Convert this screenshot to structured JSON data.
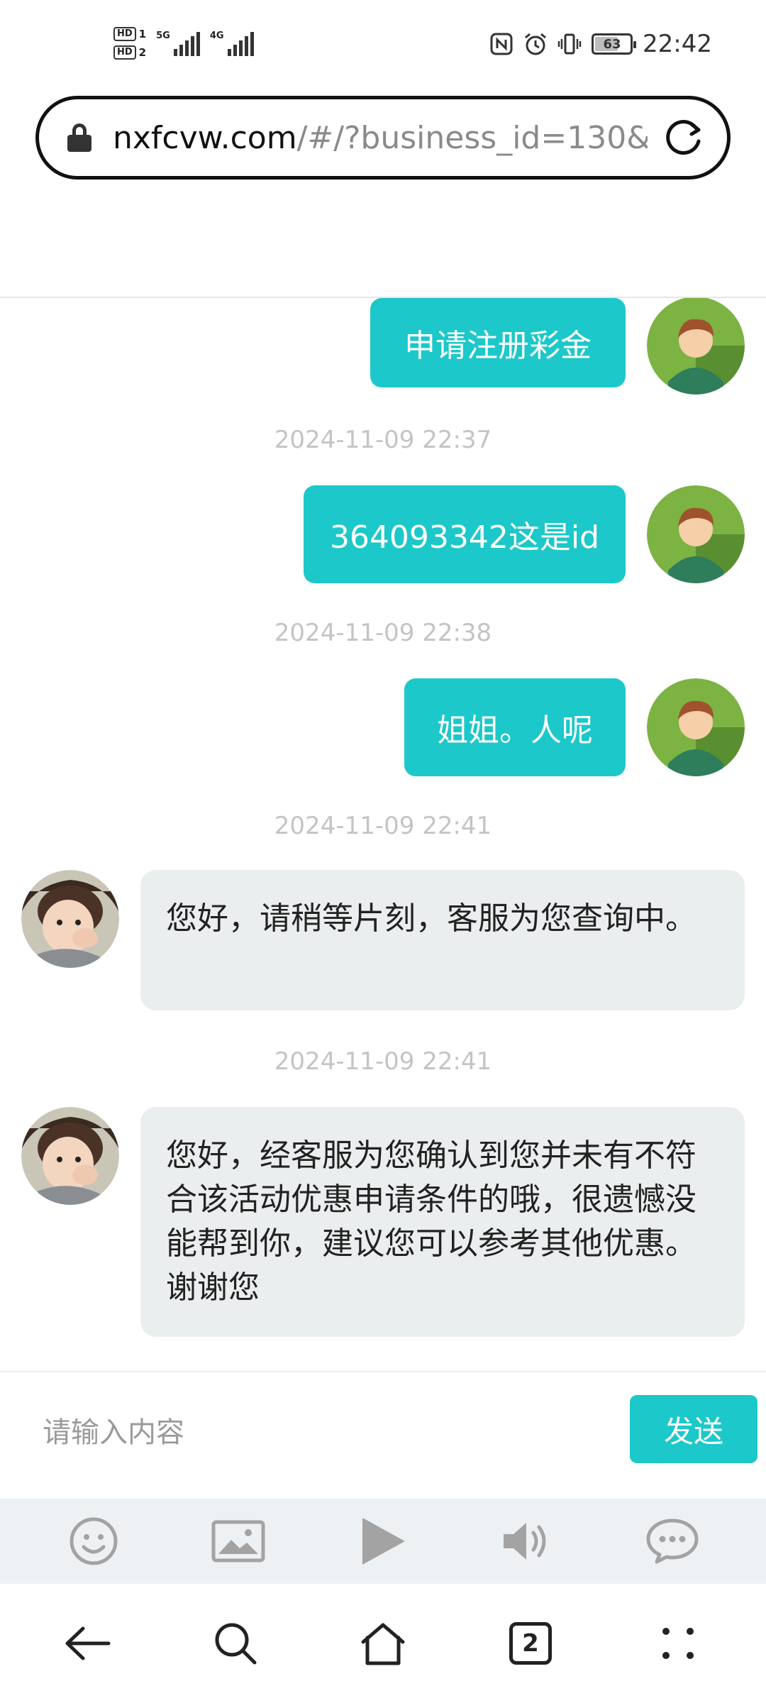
{
  "status_bar": {
    "sim1": "HD",
    "sim1_num": "1",
    "sim2": "HD",
    "sim2_num": "2",
    "net1": "5G",
    "net2": "4G",
    "battery": "63",
    "battery_level_percent": 63,
    "time": "22:42"
  },
  "browser": {
    "url_host": "nxfcvw.com",
    "url_path": "/#/?business_id=130&",
    "tabs_count": "2"
  },
  "messages": [
    {
      "side": "out",
      "text": "申请注册彩金"
    },
    {
      "side": "ts",
      "text": "2024-11-09 22:37"
    },
    {
      "side": "out",
      "text": "364093342这是id"
    },
    {
      "side": "ts",
      "text": "2024-11-09 22:38"
    },
    {
      "side": "out",
      "text": "姐姐。人呢"
    },
    {
      "side": "ts",
      "text": "2024-11-09 22:41"
    },
    {
      "side": "in",
      "text": "您好，请稍等片刻，客服为您查询中。"
    },
    {
      "side": "ts",
      "text": "2024-11-09 22:41"
    },
    {
      "side": "in",
      "text": "您好，经客服为您确认到您并未有不符合该活动优惠申请条件的哦，很遗憾没能帮到你，建议您可以参考其他优惠。谢谢您"
    }
  ],
  "composer": {
    "placeholder": "请输入内容",
    "send_label": "发送"
  },
  "toolbar": {
    "icons": [
      "emoji-icon",
      "image-icon",
      "play-icon",
      "volume-icon",
      "chat-bubble-icon"
    ]
  },
  "colors": {
    "accent": "#1cc8c9",
    "incoming_bubble": "#ebeeef",
    "timestamp": "#c4c4c4"
  }
}
